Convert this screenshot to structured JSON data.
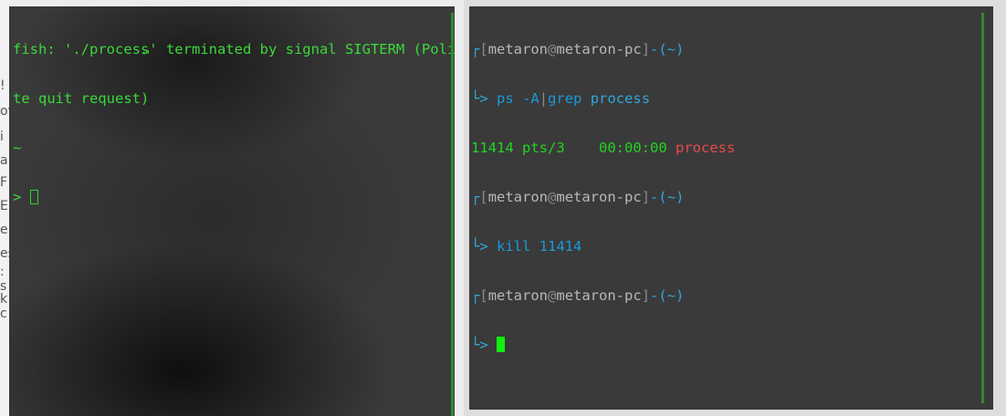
{
  "background_fragments": [
    "!",
    "ov",
    "i",
    "a",
    "F",
    "E",
    "e",
    "es",
    ":",
    "s",
    "k",
    "c"
  ],
  "left_terminal": {
    "line1": "fish: './process' terminated by signal SIGTERM (Poli",
    "line2": "te quit request)",
    "tilde": "~",
    "return_symbol": "↵",
    "prompt": "> "
  },
  "right_terminal": {
    "user": "metaron",
    "at": "@",
    "host": "metaron-pc",
    "cwd": "~",
    "cmd1": {
      "a": "ps",
      "b": "-A",
      "pipe": "|",
      "c": "grep",
      "d": "process"
    },
    "output": {
      "pid": "11414",
      "tty": "pts/3",
      "time": "00:00:00",
      "name": "process"
    },
    "cmd2": {
      "a": "kill",
      "b": "11414"
    },
    "prompt": "> "
  },
  "colors": {
    "terminal_bg": "#3a3a3a",
    "prompt_blue": "#2fa7d9",
    "green_text": "#3ad83a",
    "error_red": "#e64b4b",
    "cursor_green": "#10ef10"
  }
}
